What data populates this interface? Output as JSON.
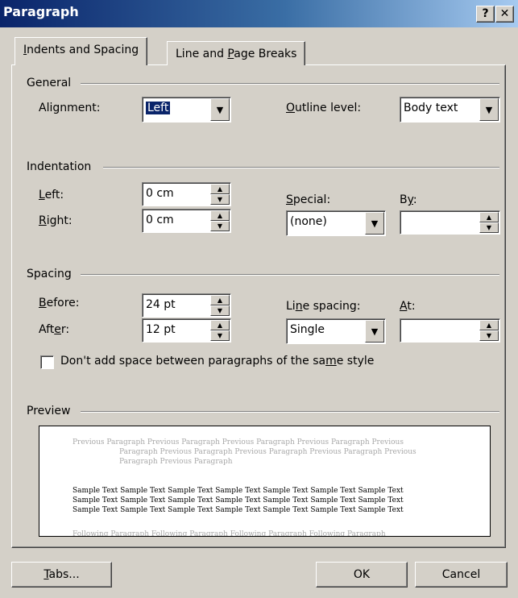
{
  "window": {
    "title": "Paragraph",
    "help_button": "?",
    "close_button": "✕"
  },
  "tabs": [
    {
      "pre": "",
      "ul": "I",
      "post": "ndents and Spacing",
      "active": true
    },
    {
      "pre": "Line and ",
      "ul": "P",
      "post": "age Breaks",
      "active": false
    }
  ],
  "general": {
    "group_label": "General",
    "alignment_label": "Alignment:",
    "alignment_value": "Left",
    "outline": {
      "ul": "O",
      "rest": "utline level:"
    },
    "outline_value": "Body text"
  },
  "indentation": {
    "group_label": "Indentation",
    "left": {
      "ul": "L",
      "rest": "eft:"
    },
    "left_value": "0 cm",
    "right": {
      "ul": "R",
      "rest": "ight:"
    },
    "right_value": "0 cm",
    "special": {
      "ul": "S",
      "rest": "pecial:"
    },
    "special_value": "(none)",
    "by": {
      "pre": "B",
      "ul": "y",
      "post": ":"
    },
    "by_value": ""
  },
  "spacing": {
    "group_label": "Spacing",
    "before": {
      "ul": "B",
      "rest": "efore:"
    },
    "before_value": "24 pt",
    "after": {
      "pre": "Aft",
      "ul": "e",
      "post": "r:"
    },
    "after_value": "12 pt",
    "line_spacing": {
      "pre": "Li",
      "ul": "n",
      "post": "e spacing:"
    },
    "line_spacing_value": "Single",
    "at": {
      "ul": "A",
      "rest": "t:"
    },
    "at_value": "",
    "no_space": {
      "pre": "Don't add space between paragraphs of the sa",
      "ul": "m",
      "post": "e style"
    },
    "no_space_checked": false
  },
  "preview": {
    "group_label": "Preview",
    "previous_lines": [
      "Previous Paragraph Previous Paragraph Previous Paragraph Previous Paragraph Previous",
      "Paragraph Previous Paragraph Previous Paragraph Previous Paragraph Previous",
      "Paragraph Previous Paragraph"
    ],
    "sample_lines": [
      "Sample Text Sample Text Sample Text Sample Text Sample Text Sample Text Sample Text",
      "Sample Text Sample Text Sample Text Sample Text Sample Text Sample Text Sample Text",
      "Sample Text Sample Text Sample Text Sample Text Sample Text Sample Text Sample Text"
    ],
    "following_line": "Following Paragraph Following Paragraph Following Paragraph Following Paragraph"
  },
  "buttons": {
    "tabs": {
      "ul": "T",
      "rest": "abs..."
    },
    "ok": "OK",
    "cancel": "Cancel"
  }
}
